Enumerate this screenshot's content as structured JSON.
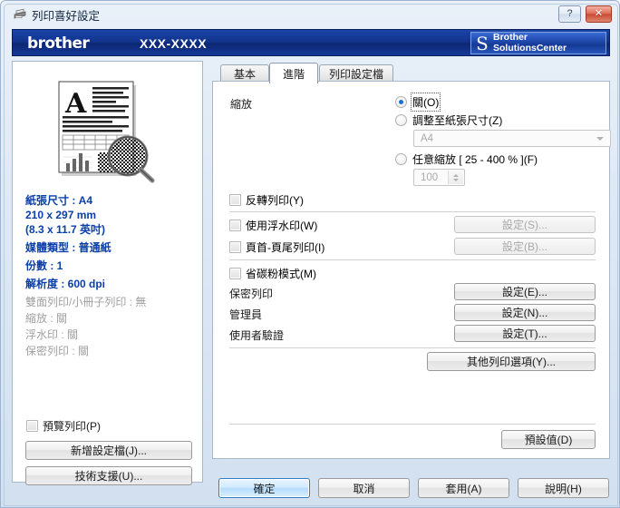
{
  "window": {
    "title": "列印喜好設定",
    "icon": "printer-icon",
    "help_button": "?",
    "close_button": "✕"
  },
  "banner": {
    "brand": "brother",
    "model": "XXX-XXXX",
    "solutions_line1": "Brother",
    "solutions_line2": "SolutionsCenter",
    "swirl_glyph": "S"
  },
  "left_panel": {
    "info": [
      {
        "text": "紙張尺寸 : A4",
        "state": "active"
      },
      {
        "text": "210 x 297 mm",
        "state": "active"
      },
      {
        "text": "(8.3 x 11.7 英吋)",
        "state": "active"
      },
      {
        "text": "媒體類型 : 普通紙",
        "state": "active"
      },
      {
        "text": "份數 : 1",
        "state": "active"
      },
      {
        "text": "解析度 : 600 dpi",
        "state": "active"
      },
      {
        "text": "雙面列印/小冊子列印 : 無",
        "state": "dim"
      },
      {
        "text": "縮放 : 關",
        "state": "dim"
      },
      {
        "text": "浮水印 : 關",
        "state": "dim"
      },
      {
        "text": "保密列印 : 關",
        "state": "dim"
      }
    ],
    "preview_checkbox_label": "預覽列印(P)",
    "preview_checkbox_checked": false,
    "add_profile_button": "新增設定檔(J)...",
    "support_button": "技術支援(U)..."
  },
  "tabs": [
    {
      "label": "基本",
      "active": false
    },
    {
      "label": "進階",
      "active": true
    },
    {
      "label": "列印設定檔",
      "active": false
    }
  ],
  "main": {
    "scaling_label": "縮放",
    "scaling_options": [
      {
        "label": "關(O)",
        "selected": true,
        "focused": true
      },
      {
        "label": "調整至紙張尺寸(Z)",
        "selected": false,
        "focused": false
      },
      {
        "label": "任意縮放 [ 25 - 400 % ](F)",
        "selected": false,
        "focused": false
      }
    ],
    "paper_size_value": "A4",
    "free_scale_value": "100",
    "checkboxes": [
      {
        "label": "反轉列印(Y)",
        "checked": false
      },
      {
        "label": "使用浮水印(W)",
        "checked": false
      },
      {
        "label": "頁首-頁尾列印(I)",
        "checked": false
      },
      {
        "label": "省碳粉模式(M)",
        "checked": false
      }
    ],
    "setting_buttons": [
      {
        "label": "設定(S)...",
        "disabled": true
      },
      {
        "label": "設定(B)...",
        "disabled": true
      },
      {
        "label": "設定(E)...",
        "disabled": false
      },
      {
        "label": "設定(N)...",
        "disabled": false
      },
      {
        "label": "設定(T)...",
        "disabled": false
      }
    ],
    "row_labels": [
      "保密列印",
      "管理員",
      "使用者驗證"
    ],
    "other_options_button": "其他列印選項(Y)...",
    "default_button": "預設值(D)"
  },
  "footer": {
    "ok": "確定",
    "cancel": "取消",
    "apply": "套用(A)",
    "help": "說明(H)"
  },
  "colors": {
    "banner_blue": "#12348c",
    "info_active": "#0a3fa8",
    "info_dim": "#a0a0a0",
    "accent": "#1a6fd4",
    "close_red": "#cb4a33"
  }
}
